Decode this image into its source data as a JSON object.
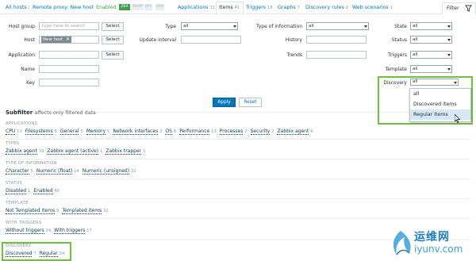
{
  "nav": {
    "all_hosts": "All hosts",
    "sep": "/",
    "host": "Remote proxy: New host",
    "status": "Enabled",
    "badges": [
      "ZBX",
      "SNMP",
      "JMX",
      "IPMI"
    ],
    "tabs": [
      {
        "label": "Applications",
        "count": "31"
      },
      {
        "label": "Items",
        "count": "41"
      },
      {
        "label": "Triggers",
        "count": "18"
      },
      {
        "label": "Graphs",
        "count": "7"
      },
      {
        "label": "Discovery rules",
        "count": "2"
      },
      {
        "label": "Web scenarios",
        "count": "1"
      }
    ],
    "filter_label": "Filter"
  },
  "filter": {
    "col1": {
      "host_group_label": "Host group",
      "host_group_placeholder": "type here to search",
      "host_label": "Host",
      "host_tag": "New host",
      "application_label": "Application",
      "name_label": "Name",
      "key_label": "Key",
      "select_label": "Select"
    },
    "col2": {
      "type_label": "Type",
      "type_value": "all",
      "update_interval_label": "Update interval"
    },
    "col3": {
      "type_info_label": "Type of information",
      "type_info_value": "all",
      "history_label": "History",
      "trends_label": "Trends"
    },
    "col4": {
      "state_label": "State",
      "state_value": "all",
      "status_label": "Status",
      "status_value": "all",
      "triggers_label": "Triggers",
      "triggers_value": "all",
      "template_label": "Template",
      "template_value": "all",
      "discovery_label": "Discovery",
      "discovery_value": "all",
      "discovery_options": [
        "all",
        "Discovered items",
        "Regular items"
      ],
      "discovery_highlighted": "Regular items"
    },
    "apply_label": "Apply",
    "reset_label": "Reset"
  },
  "subfilter": {
    "title": "Subfilter",
    "hint": "affects only filtered data",
    "groups": [
      {
        "heading": "APPLICATIONS",
        "items": [
          {
            "label": "CPU",
            "count": "13"
          },
          {
            "label": "Filesystems",
            "count": "5"
          },
          {
            "label": "General",
            "count": "5"
          },
          {
            "label": "Memory",
            "count": "5"
          },
          {
            "label": "Network interfaces",
            "count": "2"
          },
          {
            "label": "OS",
            "count": "8"
          },
          {
            "label": "Performance",
            "count": "13"
          },
          {
            "label": "Processes",
            "count": "2"
          },
          {
            "label": "Security",
            "count": "2"
          },
          {
            "label": "Zabbix agent",
            "count": "9"
          }
        ]
      },
      {
        "heading": "TYPES",
        "items": [
          {
            "label": "Zabbix agent",
            "count": "39"
          },
          {
            "label": "Zabbix agent (active)",
            "count": "1"
          },
          {
            "label": "Zabbix trapper",
            "count": "1"
          }
        ]
      },
      {
        "heading": "TYPE OF INFORMATION",
        "items": [
          {
            "label": "Character",
            "count": "5"
          },
          {
            "label": "Numeric (float)",
            "count": "14"
          },
          {
            "label": "Numeric (unsigned)",
            "count": "22"
          }
        ]
      },
      {
        "heading": "STATUS",
        "items": [
          {
            "label": "Disabled",
            "count": "1"
          },
          {
            "label": "Enabled",
            "count": "40"
          }
        ]
      },
      {
        "heading": "TEMPLATE",
        "items": [
          {
            "label": "Not Templated items",
            "count": "9"
          },
          {
            "label": "Templated items",
            "count": "32"
          }
        ]
      },
      {
        "heading": "WITH TRIGGERS",
        "items": [
          {
            "label": "Without triggers",
            "count": "24"
          },
          {
            "label": "With triggers",
            "count": "17"
          }
        ]
      },
      {
        "heading": "DISCOVERY",
        "items": [
          {
            "label": "Discovered",
            "count": "7"
          },
          {
            "label": "Regular",
            "count": "34"
          }
        ]
      }
    ]
  },
  "watermark": {
    "cn": "运维网",
    "url": "iyunv.com"
  },
  "colors": {
    "accent": "#0275b8",
    "highlight": "#6ec23e",
    "zbx_badge": "#429e47"
  }
}
